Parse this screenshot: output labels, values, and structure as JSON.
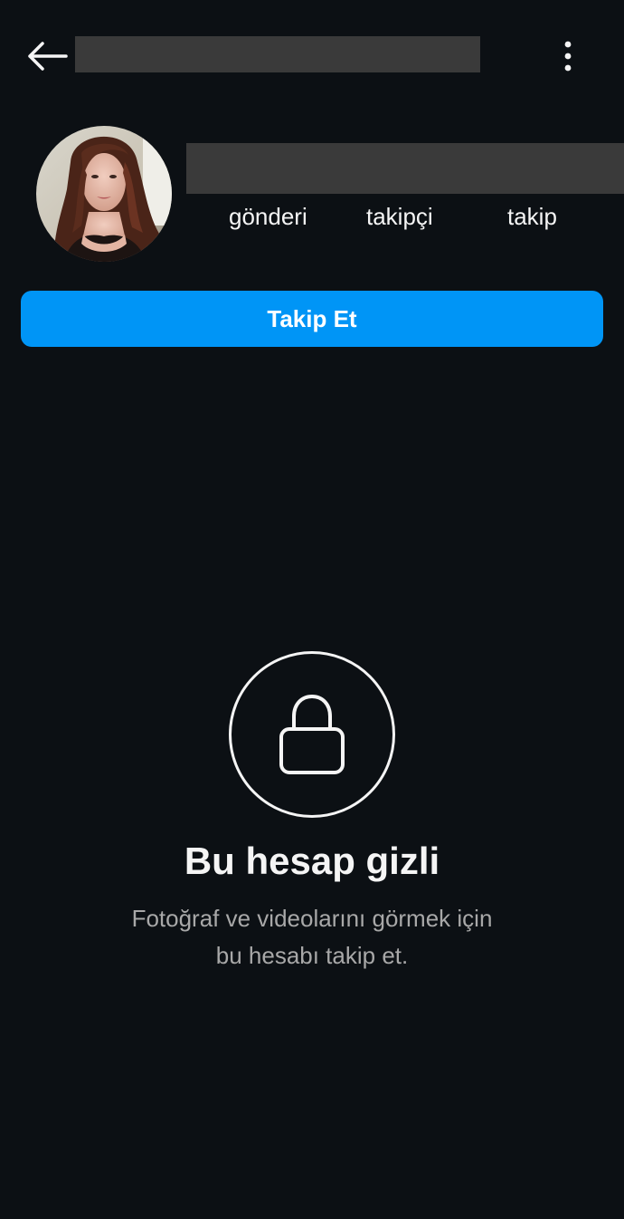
{
  "header": {
    "back_icon": "arrow-left-icon",
    "more_icon": "more-vertical-icon"
  },
  "profile": {
    "stats": {
      "posts_label": "gönderi",
      "followers_label": "takipçi",
      "following_label": "takip"
    },
    "follow_button_label": "Takip Et"
  },
  "private_notice": {
    "icon": "lock-icon",
    "title": "Bu hesap gizli",
    "description_line1": "Fotoğraf ve videolarını görmek için",
    "description_line2": "bu hesabı takip et."
  },
  "colors": {
    "background": "#0c1014",
    "accent": "#0095f6",
    "text_primary": "#f5f5f5",
    "text_secondary": "#a8a8a8",
    "redaction": "#3a3a3a"
  }
}
